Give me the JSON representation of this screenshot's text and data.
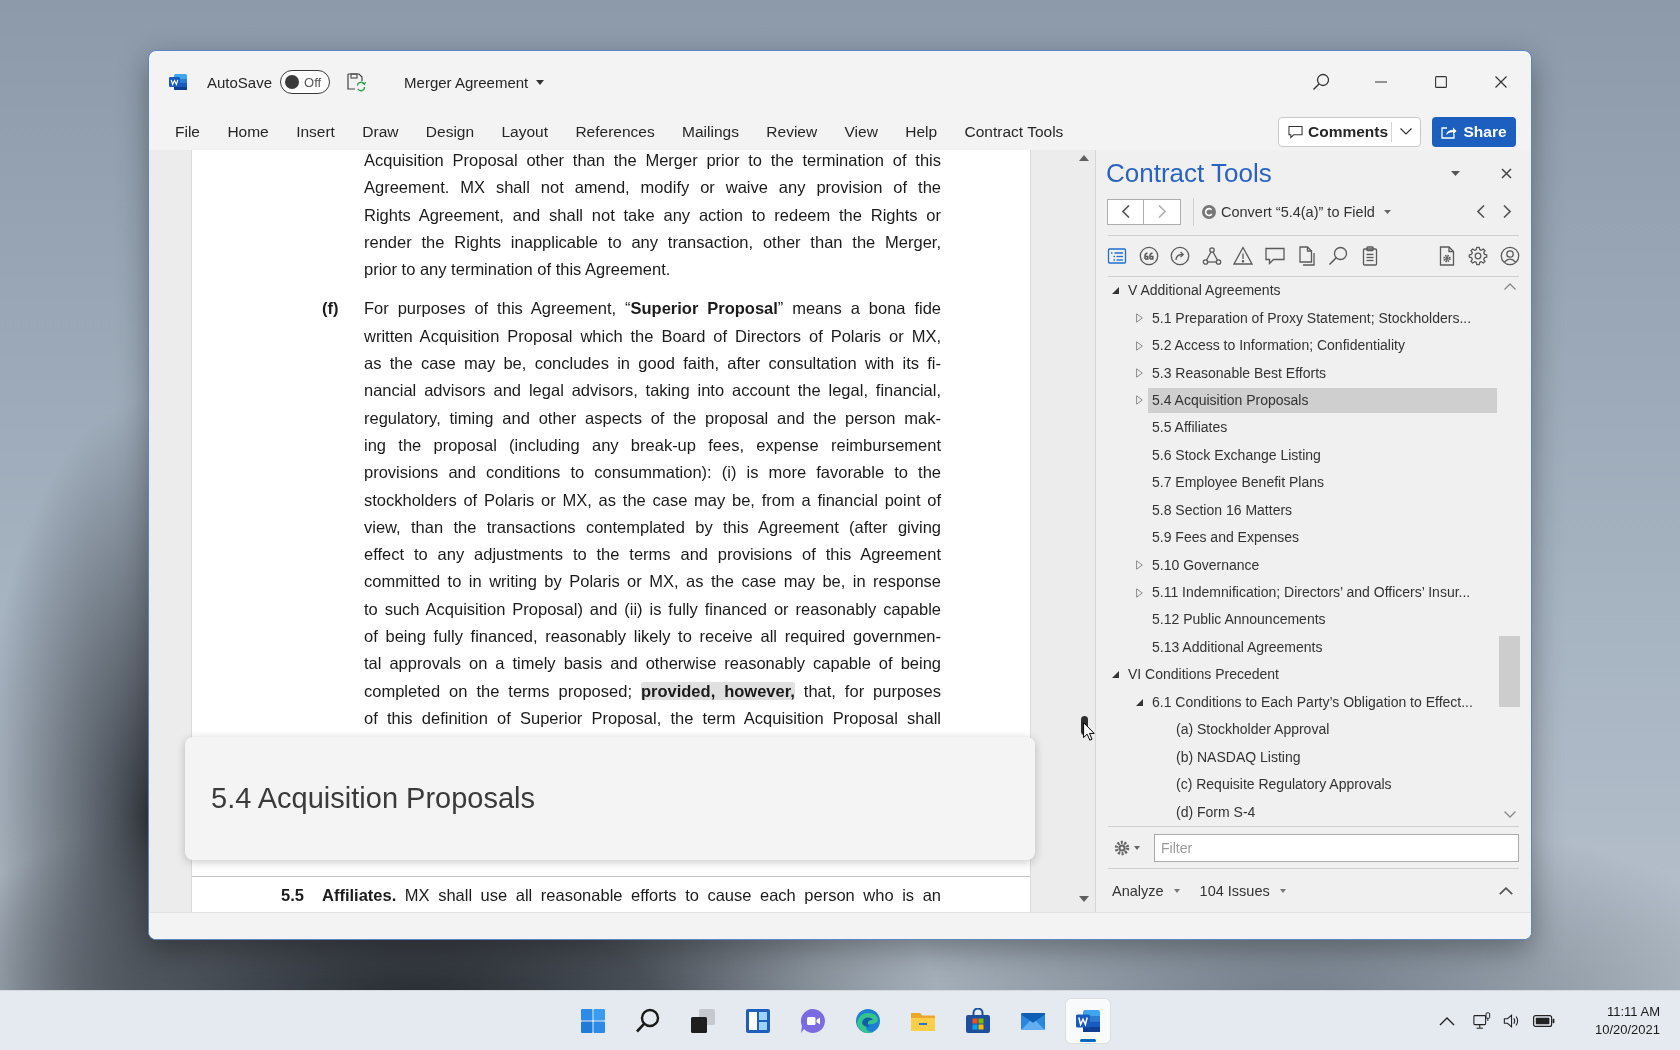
{
  "title_bar": {
    "autosave_label": "AutoSave",
    "autosave": {
      "on": false,
      "label": "Off"
    },
    "document_name": "Merger Agreement"
  },
  "ribbon": {
    "tabs": [
      {
        "label": "File",
        "selected": false
      },
      {
        "label": "Home",
        "selected": false
      },
      {
        "label": "Insert",
        "selected": false
      },
      {
        "label": "Draw",
        "selected": false
      },
      {
        "label": "Design",
        "selected": false
      },
      {
        "label": "Layout",
        "selected": false
      },
      {
        "label": "References",
        "selected": false
      },
      {
        "label": "Mailings",
        "selected": false
      },
      {
        "label": "Review",
        "selected": false
      },
      {
        "label": "View",
        "selected": false
      },
      {
        "label": "Help",
        "selected": false
      },
      {
        "label": "Contract Tools",
        "selected": false
      }
    ],
    "comments_button": "Comments",
    "share_button": "Share"
  },
  "document": {
    "page_1": [
      {
        "kind": "continuation",
        "continues": false,
        "lines": [
          "Acquisition Proposal other than the Merger prior to the termination of this",
          "Agreement. MX shall not amend, modify or waive any provision of the",
          "Rights Agreement, and shall not take any action to redeem the Rights or",
          "render the Rights inapplicable to any transaction, other than the Merger,",
          "prior to any termination of this Agreement."
        ]
      },
      {
        "kind": "item",
        "label": "(f)",
        "continues": true,
        "lines": [
          "For purposes of this Agreement, “**Superior Proposal**” means a bona fide",
          "written Acquisition Proposal which the Board of Directors of Polaris or MX,",
          "as the case may be, concludes in good faith, after consultation with its fi-",
          "nancial advisors and legal advisors, taking into account the legal, financial,",
          "regulatory, timing and other aspects of the proposal and the person mak-",
          "ing the proposal (including any break-up fees, expense reimbursement",
          "provisions and conditions to consummation): (i) is more favorable to the",
          "stockholders of Polaris or MX, as the case may be, from a financial point of",
          "view, than the transactions contemplated by this Agreement (after giving",
          "effect to any adjustments to the terms and provisions of this Agreement",
          "committed to in writing by Polaris or MX, as the case may be, in response",
          "to such Acquisition Proposal) and (ii) is fully financed or reasonably capable",
          "of being fully financed, reasonably likely to receive all required governmen-",
          "tal approvals on a timely basis and otherwise reasonably capable of being",
          {
            "text": "completed on the terms proposed; ",
            "highlight": "**provided, however,**",
            "rest": " that, for purposes"
          },
          "of this definition of Superior Proposal, the term Acquisition Proposal shall"
        ]
      }
    ],
    "page_2": [
      {
        "kind": "section",
        "label": "5.5",
        "continues": true,
        "lines": [
          "**Affiliates.** MX shall use all reasonable efforts to cause each person who is an"
        ]
      }
    ],
    "heading_popup": "5.4 Acquisition Proposals"
  },
  "contract_tools": {
    "title": "Contract Tools",
    "back": {
      "disabled": false
    },
    "forward": {
      "disabled": true
    },
    "command": "Convert “5.4(a)” to Field",
    "tools": [
      {
        "kind": "outline",
        "selected": true
      },
      {
        "kind": "quotes",
        "selected": false
      },
      {
        "kind": "redirect",
        "selected": false
      },
      {
        "kind": "links",
        "selected": false
      },
      {
        "kind": "warnings",
        "selected": false
      },
      {
        "kind": "comments",
        "selected": false
      },
      {
        "kind": "documents",
        "selected": false
      },
      {
        "kind": "search",
        "selected": false
      },
      {
        "kind": "clipboard",
        "selected": false
      }
    ],
    "side_tools": [
      {
        "kind": "document-settings",
        "selected": false
      },
      {
        "kind": "settings",
        "selected": false
      },
      {
        "kind": "account",
        "selected": false
      }
    ],
    "tree": [
      {
        "label": "V Additional Agreements",
        "kind": "branch",
        "expanded": true,
        "selected": false,
        "children": [
          {
            "label": "5.1 Preparation of Proxy Statement; Stockholders...",
            "kind": "branch",
            "expanded": false,
            "selected": false
          },
          {
            "label": "5.2 Access to Information; Confidentiality",
            "kind": "branch",
            "expanded": false,
            "selected": false
          },
          {
            "label": "5.3 Reasonable Best Efforts",
            "kind": "branch",
            "expanded": false,
            "selected": false
          },
          {
            "label": "5.4 Acquisition Proposals",
            "kind": "branch",
            "expanded": false,
            "selected": true
          },
          {
            "label": "5.5 Affiliates",
            "kind": "leaf",
            "selected": false
          },
          {
            "label": "5.6 Stock Exchange Listing",
            "kind": "leaf",
            "selected": false
          },
          {
            "label": "5.7 Employee Benefit Plans",
            "kind": "leaf",
            "selected": false
          },
          {
            "label": "5.8 Section 16 Matters",
            "kind": "leaf",
            "selected": false
          },
          {
            "label": "5.9 Fees and Expenses",
            "kind": "leaf",
            "selected": false
          },
          {
            "label": "5.10 Governance",
            "kind": "branch",
            "expanded": false,
            "selected": false
          },
          {
            "label": "5.11 Indemnification; Directors’ and Officers’ Insur...",
            "kind": "branch",
            "expanded": false,
            "selected": false
          },
          {
            "label": "5.12 Public Announcements",
            "kind": "leaf",
            "selected": false
          },
          {
            "label": "5.13 Additional Agreements",
            "kind": "leaf",
            "selected": false
          }
        ]
      },
      {
        "label": "VI Conditions Precedent",
        "kind": "branch",
        "expanded": true,
        "selected": false,
        "children": [
          {
            "label": "6.1 Conditions to Each Party’s Obligation to Effect...",
            "kind": "branch",
            "expanded": true,
            "selected": false,
            "children": [
              {
                "label": "(a) Stockholder Approval",
                "kind": "leaf",
                "selected": false
              },
              {
                "label": "(b) NASDAQ Listing",
                "kind": "leaf",
                "selected": false
              },
              {
                "label": "(c) Requisite Regulatory Approvals",
                "kind": "leaf",
                "selected": false
              },
              {
                "label": "(d) Form S-4",
                "kind": "leaf",
                "selected": false
              }
            ]
          }
        ]
      }
    ],
    "filter": {
      "placeholder": "Filter"
    },
    "analyze": "Analyze",
    "issues": "104 Issues"
  },
  "taskbar": {
    "apps": [
      {
        "kind": "start",
        "selected": false
      },
      {
        "kind": "search",
        "selected": false
      },
      {
        "kind": "task-view",
        "selected": false
      },
      {
        "kind": "widgets",
        "selected": false
      },
      {
        "kind": "chat",
        "selected": false
      },
      {
        "kind": "browser",
        "selected": false
      },
      {
        "kind": "files",
        "selected": false
      },
      {
        "kind": "store",
        "selected": false
      },
      {
        "kind": "mail",
        "selected": false
      },
      {
        "kind": "word",
        "selected": true
      }
    ],
    "time": "11:11 AM",
    "date": "10/20/2021"
  }
}
